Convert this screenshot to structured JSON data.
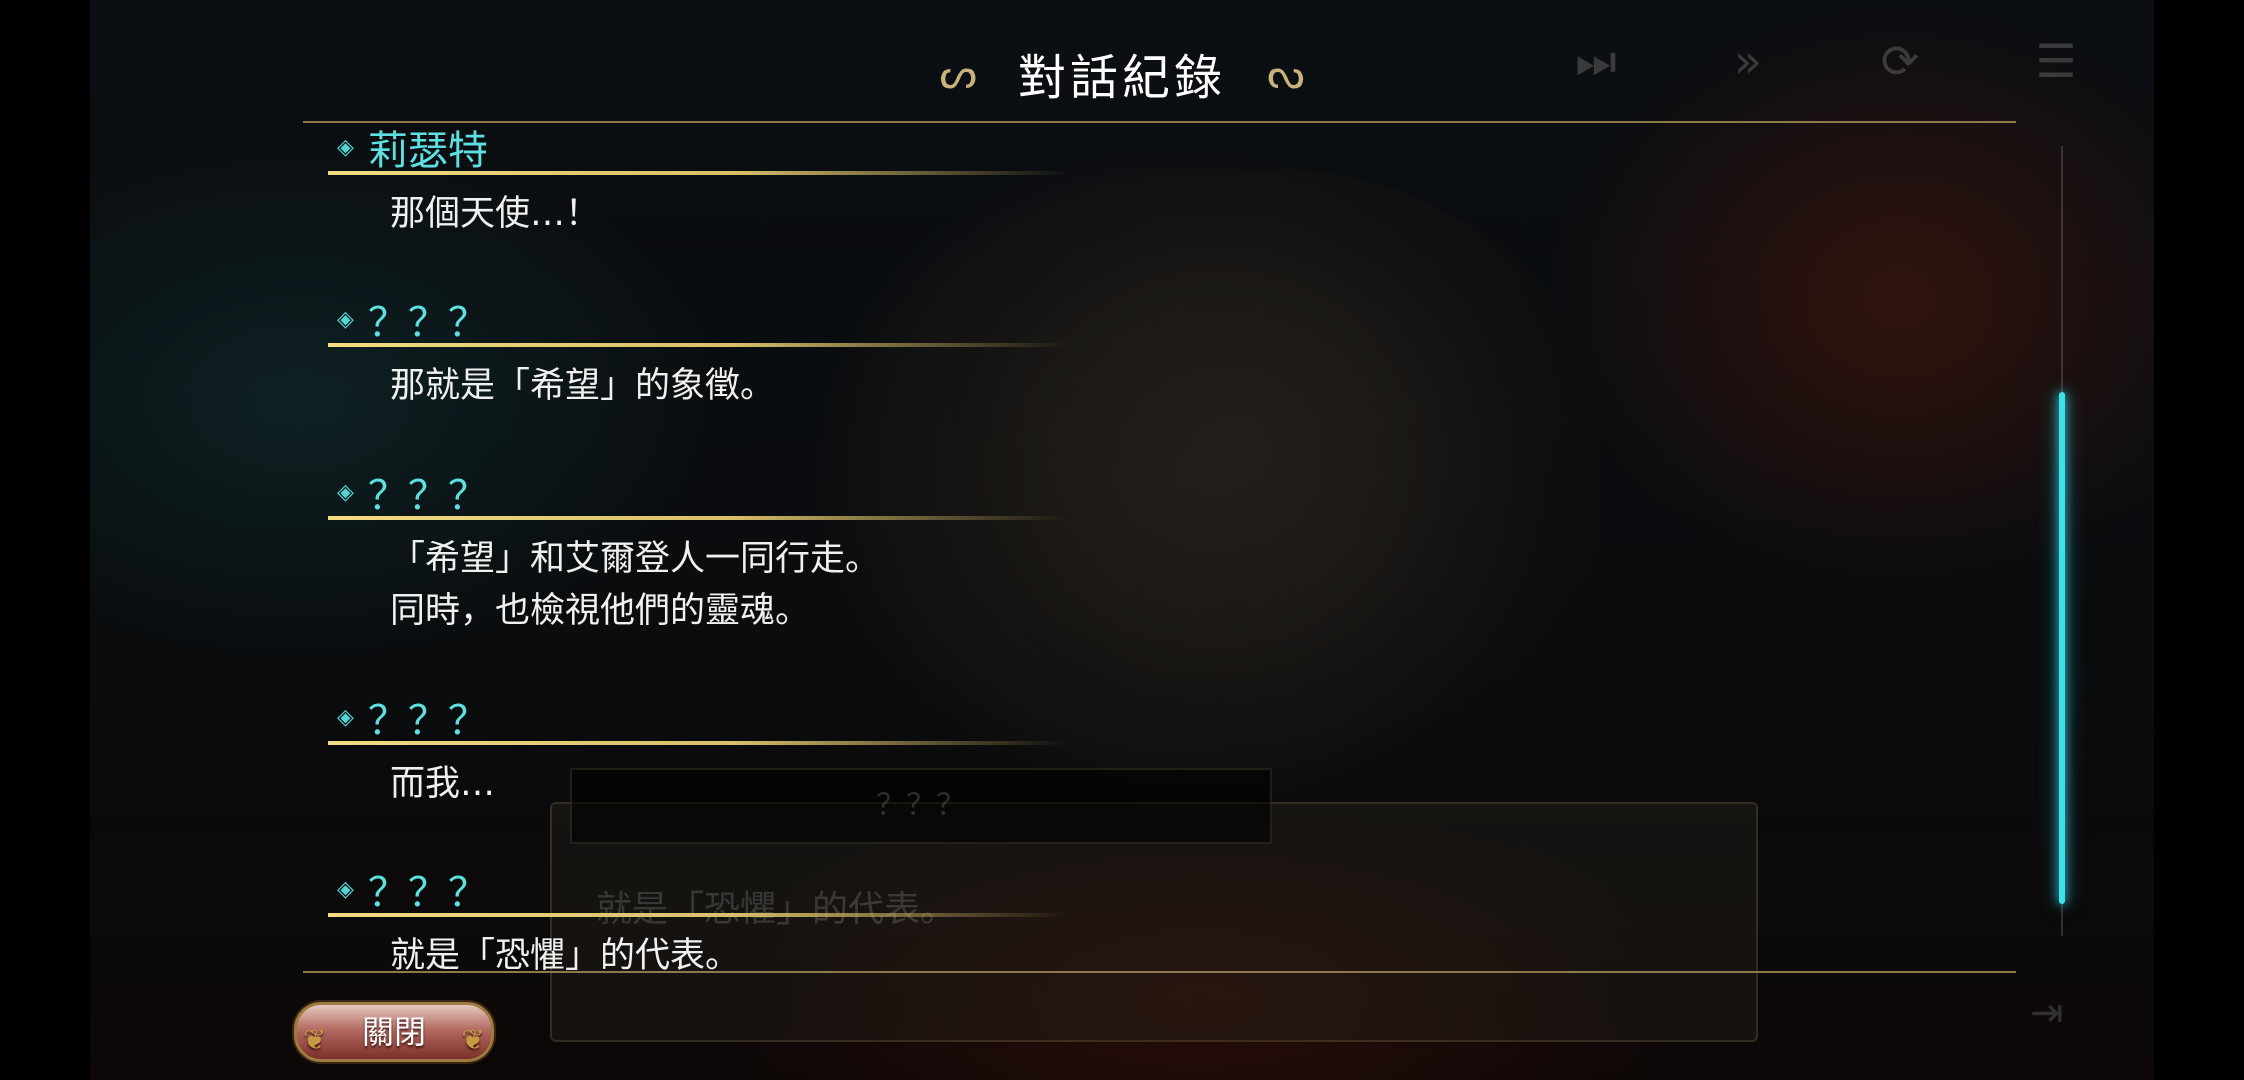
{
  "header": {
    "title": "對話紀錄"
  },
  "top_icons": [
    "skip-to-end-icon",
    "fast-forward-icon",
    "auto-play-icon",
    "log-icon"
  ],
  "log": [
    {
      "speaker": "莉瑟特",
      "lines": [
        "那個天使…！"
      ]
    },
    {
      "speaker": "？？？",
      "lines": [
        "那就是「希望」的象徵。"
      ]
    },
    {
      "speaker": "？？？",
      "lines": [
        "「希望」和艾爾登人一同行走。",
        "同時，也檢視他們的靈魂。"
      ]
    },
    {
      "speaker": "？？？",
      "lines": [
        "而我…"
      ]
    },
    {
      "speaker": "？？？",
      "lines": [
        "就是「恐懼」的代表。"
      ]
    }
  ],
  "background_dialog": {
    "name": "？？？",
    "text": "就是「恐懼」的代表。"
  },
  "scroll": {
    "position": 0.45
  },
  "close_button": {
    "label": "關閉"
  },
  "colors": {
    "speaker": "#5ee0e0",
    "accent_gold": "#d9c068",
    "scrollbar": "#40e0ea"
  }
}
